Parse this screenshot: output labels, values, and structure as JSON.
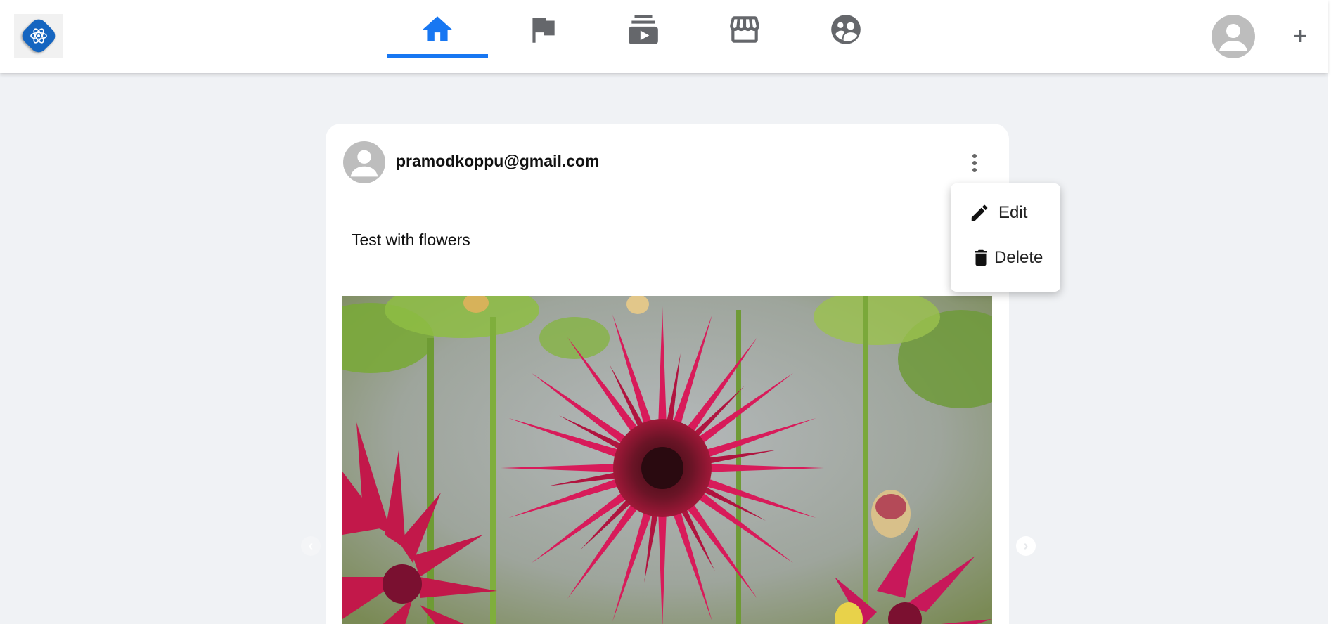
{
  "topbar": {
    "logo": {
      "icon": "atom-icon",
      "color": "#1565c0"
    },
    "nav_tabs": [
      {
        "id": "home",
        "icon": "home-icon",
        "active": true,
        "color": "#1877f2"
      },
      {
        "id": "pages",
        "icon": "flag-icon",
        "active": false,
        "color": "#65676b"
      },
      {
        "id": "watch",
        "icon": "video-stack-icon",
        "active": false,
        "color": "#65676b"
      },
      {
        "id": "marketplace",
        "icon": "storefront-icon",
        "active": false,
        "color": "#65676b"
      },
      {
        "id": "groups",
        "icon": "groups-icon",
        "active": false,
        "color": "#65676b"
      }
    ],
    "create_label": "+"
  },
  "post": {
    "author": "pramodkoppu@gmail.com",
    "text": "Test with flowers",
    "image": {
      "subject": "red dahlia flowers"
    }
  },
  "post_menu": {
    "items": [
      {
        "label": "Edit",
        "icon": "pencil-icon"
      },
      {
        "label": "Delete",
        "icon": "trash-icon"
      }
    ]
  },
  "carousel": {
    "prev_label": "‹",
    "next_label": "›"
  }
}
